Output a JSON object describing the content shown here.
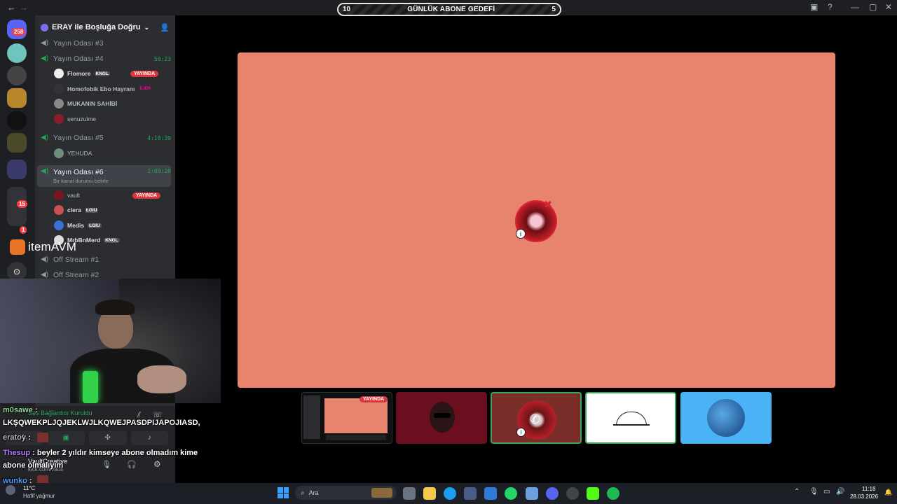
{
  "window": {
    "goal_left": "10",
    "goal_title": "GÜNLÜK ABONE GEDEFİ",
    "goal_right": "5"
  },
  "rail": {
    "home_badge": "258",
    "folder_badge_1": "15",
    "folder_badge_2": "1"
  },
  "guild": {
    "name": "ERAY ile Boşluğa Doğru"
  },
  "channels": [
    {
      "name": "Yayın Odası #3",
      "timer": ""
    },
    {
      "name": "Yayın Odası #4",
      "timer": "50:23"
    },
    {
      "name": "Yayın Odası #5",
      "timer": "4:18:39"
    },
    {
      "name": "Yayın Odası #6",
      "timer": "1:09:26",
      "status": "Bir kanal durumu belirle"
    },
    {
      "name": "Off Stream #1",
      "timer": ""
    },
    {
      "name": "Off Stream #2",
      "timer": ""
    }
  ],
  "room4_users": [
    {
      "name": "Flomore",
      "tag": "KNGL",
      "live": "YAYINDA"
    },
    {
      "name": "Homofobik Ebo Hayranı",
      "tag": "EJDR"
    },
    {
      "name": "MUKANIN SAHİBİ"
    },
    {
      "name": "senuzulme"
    }
  ],
  "room5_users": [
    {
      "name": "YEHUDA"
    }
  ],
  "room6_users": [
    {
      "name": "vault",
      "live": "YAYINDA"
    },
    {
      "name": "clera",
      "tag": "ŁGIU"
    },
    {
      "name": "Medis",
      "tag": "ŁGIU"
    },
    {
      "name": "MrbBnMerd",
      "tag": "KNGL"
    }
  ],
  "overlay": {
    "brand": "itemAVM",
    "voice_status": "Ses Bağlantısı Kuruldu",
    "panel_user": "VaultCreative",
    "panel_sub": "kick.com/vault"
  },
  "chat": [
    {
      "nick": "m0sawe",
      "text": ""
    },
    {
      "nick": "",
      "text": "LKŞQWEKPLJQJEKLWJLKQWEJPASDPIJAPOJIASD,"
    },
    {
      "nick": "eratoy",
      "text": ""
    },
    {
      "nick": "Thesup",
      "text": " : beyler 2 yıldır kimseye abone olmadım kime"
    },
    {
      "nick": "",
      "text": "abone olmalıyım"
    },
    {
      "nick": "wunko",
      "text": ""
    }
  ],
  "tiles": {
    "screen_live": "YAYINDA"
  },
  "taskbar": {
    "search": "Ara",
    "weather_temp": "11°C",
    "weather_desc": "Hafif yağmur",
    "time": "11:18",
    "date": "28.03.2026"
  }
}
